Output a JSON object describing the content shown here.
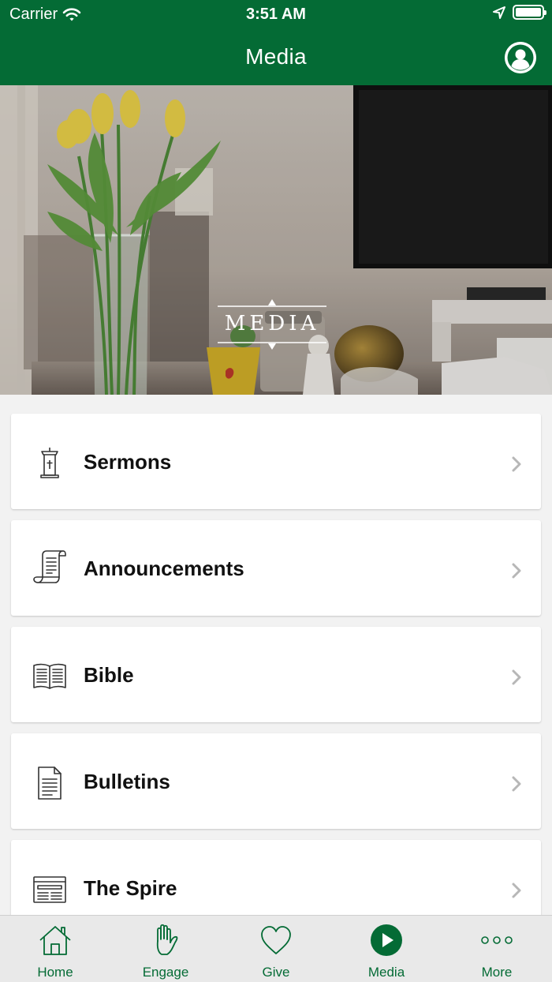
{
  "status_bar": {
    "carrier": "Carrier",
    "time": "3:51 AM"
  },
  "nav": {
    "title": "Media"
  },
  "hero": {
    "badge_text": "MEDIA"
  },
  "menu": {
    "items": [
      {
        "label": "Sermons",
        "icon": "pulpit-icon"
      },
      {
        "label": "Announcements",
        "icon": "scroll-icon"
      },
      {
        "label": "Bible",
        "icon": "open-book-icon"
      },
      {
        "label": "Bulletins",
        "icon": "document-icon"
      },
      {
        "label": "The Spire",
        "icon": "newspaper-icon"
      }
    ]
  },
  "tabs": [
    {
      "label": "Home",
      "icon": "home-icon"
    },
    {
      "label": "Engage",
      "icon": "hand-icon"
    },
    {
      "label": "Give",
      "icon": "heart-icon"
    },
    {
      "label": "Media",
      "icon": "play-icon",
      "active": true
    },
    {
      "label": "More",
      "icon": "more-dots-icon"
    }
  ],
  "colors": {
    "brand_green": "#046b35",
    "tab_bar_bg": "#e9e9e9",
    "list_bg": "#f2f2f2"
  }
}
